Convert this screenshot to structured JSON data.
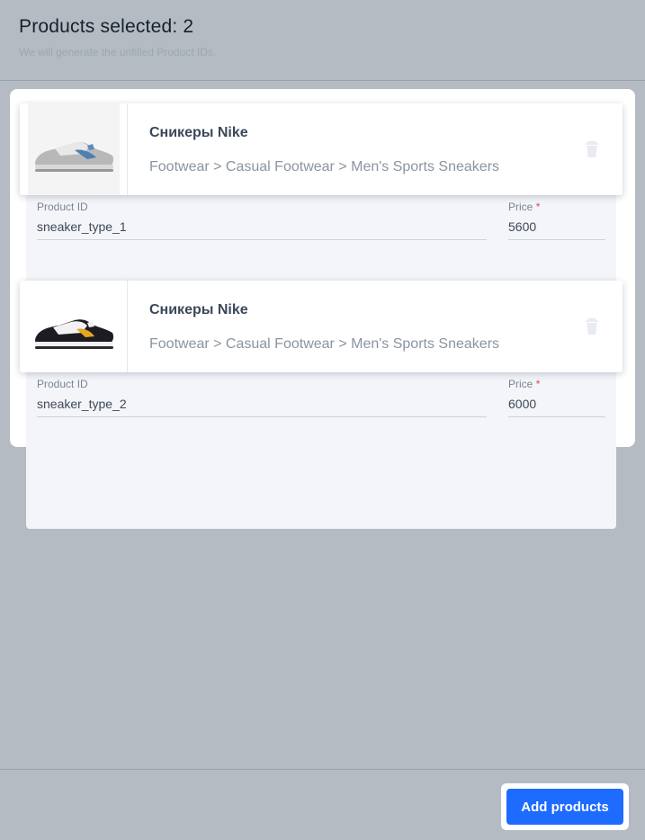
{
  "header": {
    "title": "Products selected: 2",
    "subtitle": "We will generate the unfilled Product IDs."
  },
  "products": [
    {
      "name": "Сникеры Nike",
      "category": "Footwear > Casual Footwear > Men's Sports Sneakers",
      "product_id_label": "Product ID",
      "product_id": "sneaker_type_1",
      "price_label": "Price",
      "price_required": "*",
      "price": "5600",
      "image_icon": "grey-white-blue-sneaker-image"
    },
    {
      "name": "Сникеры Nike",
      "category": "Footwear > Casual Footwear > Men's Sports Sneakers",
      "product_id_label": "Product ID",
      "product_id": "sneaker_type_2",
      "price_label": "Price",
      "price_required": "*",
      "price": "6000",
      "image_icon": "black-white-yellow-sneaker-image"
    }
  ],
  "footer": {
    "add_button_label": "Add products"
  },
  "colors": {
    "accent": "#1e6bff",
    "required": "#e0445a"
  }
}
